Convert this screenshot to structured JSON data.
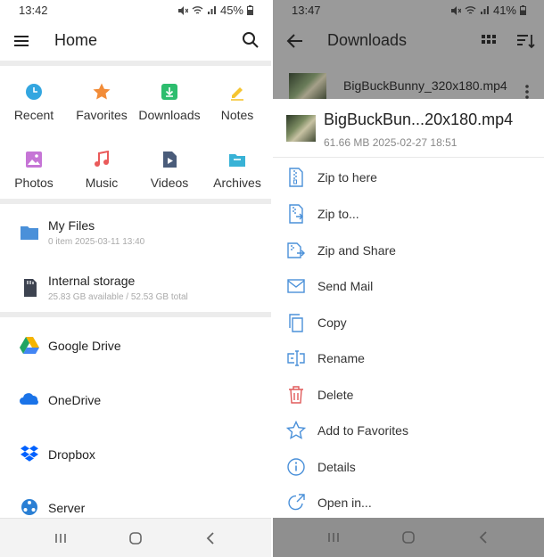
{
  "left": {
    "status": {
      "time": "13:42",
      "battery": "45%"
    },
    "header": {
      "title": "Home"
    },
    "categories": [
      {
        "label": "Recent",
        "icon": "clock-icon",
        "color": "#33a6e0"
      },
      {
        "label": "Favorites",
        "icon": "star-icon",
        "color": "#f28c38"
      },
      {
        "label": "Downloads",
        "icon": "download-icon",
        "color": "#2dbd6e"
      },
      {
        "label": "Notes",
        "icon": "pencil-icon",
        "color": "#f5c531"
      },
      {
        "label": "Photos",
        "icon": "image-icon",
        "color": "#c675d6"
      },
      {
        "label": "Music",
        "icon": "music-note-icon",
        "color": "#ea5a5a"
      },
      {
        "label": "Videos",
        "icon": "video-icon",
        "color": "#4a5c7a"
      },
      {
        "label": "Archives",
        "icon": "archive-icon",
        "color": "#38b2d6"
      }
    ],
    "storage": [
      {
        "title": "My Files",
        "subtitle": "0 item  2025-03-11 13:40",
        "icon": "folder-icon"
      },
      {
        "title": "Internal storage",
        "subtitle": "25.83 GB available / 52.53 GB total",
        "icon": "sd-card-icon"
      }
    ],
    "cloud": [
      {
        "title": "Google Drive",
        "icon": "google-drive-icon"
      },
      {
        "title": "OneDrive",
        "icon": "onedrive-icon"
      },
      {
        "title": "Dropbox",
        "icon": "dropbox-icon"
      },
      {
        "title": "Server",
        "icon": "server-icon"
      }
    ]
  },
  "right": {
    "status": {
      "time": "13:47",
      "battery": "41%"
    },
    "header": {
      "title": "Downloads"
    },
    "background_file": {
      "name": "BigBuckBunny_320x180.mp4"
    },
    "sheet": {
      "file_name": "BigBuckBun...20x180.mp4",
      "file_meta": "61.66 MB  2025-02-27 18:51",
      "options": [
        {
          "label": "Zip to here",
          "icon": "zip-icon"
        },
        {
          "label": "Zip to...",
          "icon": "zip-arrow-icon"
        },
        {
          "label": "Zip and Share",
          "icon": "zip-share-icon"
        },
        {
          "label": "Send Mail",
          "icon": "mail-icon"
        },
        {
          "label": "Copy",
          "icon": "copy-icon"
        },
        {
          "label": "Rename",
          "icon": "rename-icon"
        },
        {
          "label": "Delete",
          "icon": "trash-icon"
        },
        {
          "label": "Add to Favorites",
          "icon": "star-outline-icon"
        },
        {
          "label": "Details",
          "icon": "info-icon"
        },
        {
          "label": "Open in...",
          "icon": "open-external-icon"
        }
      ]
    }
  },
  "colors": {
    "accent": "#4a90d9",
    "delete": "#e05a5a",
    "dim_overlay": "#9a9a9a"
  }
}
